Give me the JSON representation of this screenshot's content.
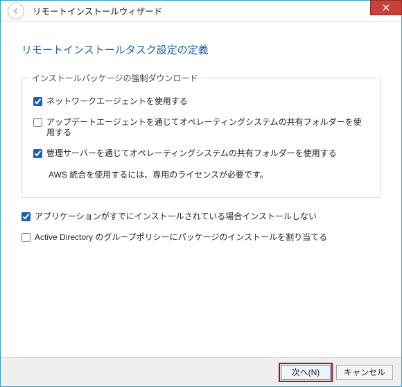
{
  "titlebar": {
    "title": "リモートインストールウィザード"
  },
  "page": {
    "heading": "リモートインストールタスク設定の定義"
  },
  "group": {
    "title": "インストールパッケージの強制ダウンロード",
    "opt1": {
      "label": "ネットワークエージェントを使用する",
      "checked": true
    },
    "opt2": {
      "label": "アップデートエージェントを通じてオペレーティングシステムの共有フォルダーを使用する",
      "checked": false
    },
    "opt3": {
      "label": "管理サーバーを通じてオペレーティングシステムの共有フォルダーを使用する",
      "checked": true
    },
    "note": "AWS 統合を使用するには、専用のライセンスが必要です。"
  },
  "extras": {
    "opt4": {
      "label": "アプリケーションがすでにインストールされている場合インストールしない",
      "checked": true
    },
    "opt5": {
      "label": "Active Directory のグループポリシーにパッケージのインストールを割り当てる",
      "checked": false
    }
  },
  "footer": {
    "next": "次へ(N)",
    "cancel": "キャンセル"
  }
}
